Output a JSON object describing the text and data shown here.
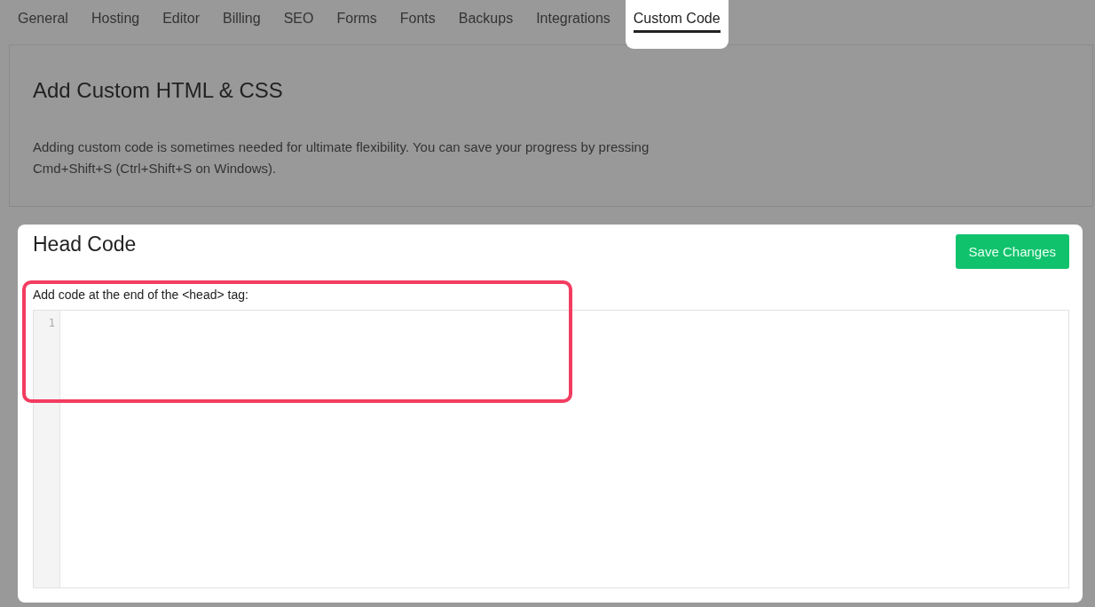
{
  "tabs": [
    {
      "label": "General",
      "selected": false
    },
    {
      "label": "Hosting",
      "selected": false
    },
    {
      "label": "Editor",
      "selected": false
    },
    {
      "label": "Billing",
      "selected": false
    },
    {
      "label": "SEO",
      "selected": false
    },
    {
      "label": "Forms",
      "selected": false
    },
    {
      "label": "Fonts",
      "selected": false
    },
    {
      "label": "Backups",
      "selected": false
    },
    {
      "label": "Integrations",
      "selected": false
    },
    {
      "label": "Custom Code",
      "selected": true
    }
  ],
  "intro": {
    "title": "Add Custom HTML & CSS",
    "description": "Adding custom code is sometimes needed for ultimate flexibility. You can save your progress by pressing Cmd+Shift+S (Ctrl+Shift+S on Windows)."
  },
  "head_code": {
    "title": "Head Code",
    "save_button": "Save Changes",
    "label": "Add code at the end of the <head> tag:",
    "line_numbers": [
      "1"
    ],
    "highlighted": true
  }
}
